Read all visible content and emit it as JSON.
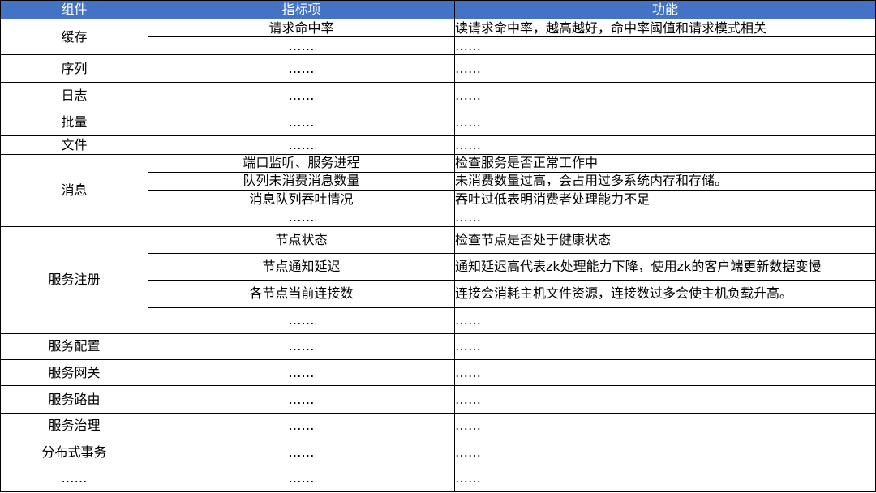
{
  "header": {
    "component": "组件",
    "metric": "指标项",
    "function": "功能"
  },
  "components": [
    {
      "name": "缓存",
      "rows": [
        {
          "metric": "请求命中率",
          "function": "读请求命中率，越高越好，命中率阈值和请求模式相关",
          "height": 22
        },
        {
          "metric": "……",
          "function": "……",
          "height": 22
        }
      ]
    },
    {
      "name": "序列",
      "rows": [
        {
          "metric": "……",
          "function": "……",
          "height": 33
        }
      ]
    },
    {
      "name": "日志",
      "rows": [
        {
          "metric": "……",
          "function": "……",
          "height": 33
        }
      ]
    },
    {
      "name": "批量",
      "rows": [
        {
          "metric": "……",
          "function": "……",
          "height": 33
        }
      ]
    },
    {
      "name": "文件",
      "rows": [
        {
          "metric": "……",
          "function": "……",
          "height": 22
        }
      ]
    },
    {
      "name": "消息",
      "rows": [
        {
          "metric": "端口监听、服务进程",
          "function": "检查服务是否正常工作中",
          "height": 22
        },
        {
          "metric": "队列未消费消息数量",
          "function": "未消费数量过高，会占用过多系统内存和存储。",
          "height": 22
        },
        {
          "metric": "消息队列吞吐情况",
          "function": "吞吐过低表明消费者处理能力不足",
          "height": 22
        },
        {
          "metric": "……",
          "function": "……",
          "height": 22
        }
      ]
    },
    {
      "name": "服务注册",
      "rows": [
        {
          "metric": "节点状态",
          "function": "检查节点是否处于健康状态",
          "height": 33
        },
        {
          "metric": "节点通知延迟",
          "function": "通知延迟高代表zk处理能力下降，使用zk的客户端更新数据变慢",
          "height": 33
        },
        {
          "metric": "各节点当前连接数",
          "function": "连接会消耗主机文件资源，连接数过多会使主机负载升高。",
          "height": 33
        },
        {
          "metric": "……",
          "function": "……",
          "height": 32
        }
      ]
    },
    {
      "name": "服务配置",
      "rows": [
        {
          "metric": "……",
          "function": "……",
          "height": 32
        }
      ]
    },
    {
      "name": "服务网关",
      "rows": [
        {
          "metric": "……",
          "function": "……",
          "height": 32
        }
      ]
    },
    {
      "name": "服务路由",
      "rows": [
        {
          "metric": "……",
          "function": "……",
          "height": 33
        }
      ]
    },
    {
      "name": "服务治理",
      "rows": [
        {
          "metric": "……",
          "function": "……",
          "height": 32
        }
      ]
    },
    {
      "name": "分布式事务",
      "rows": [
        {
          "metric": "……",
          "function": "……",
          "height": 32
        }
      ]
    },
    {
      "name": "……",
      "rows": [
        {
          "metric": "……",
          "function": "……",
          "height": 32
        }
      ]
    }
  ]
}
